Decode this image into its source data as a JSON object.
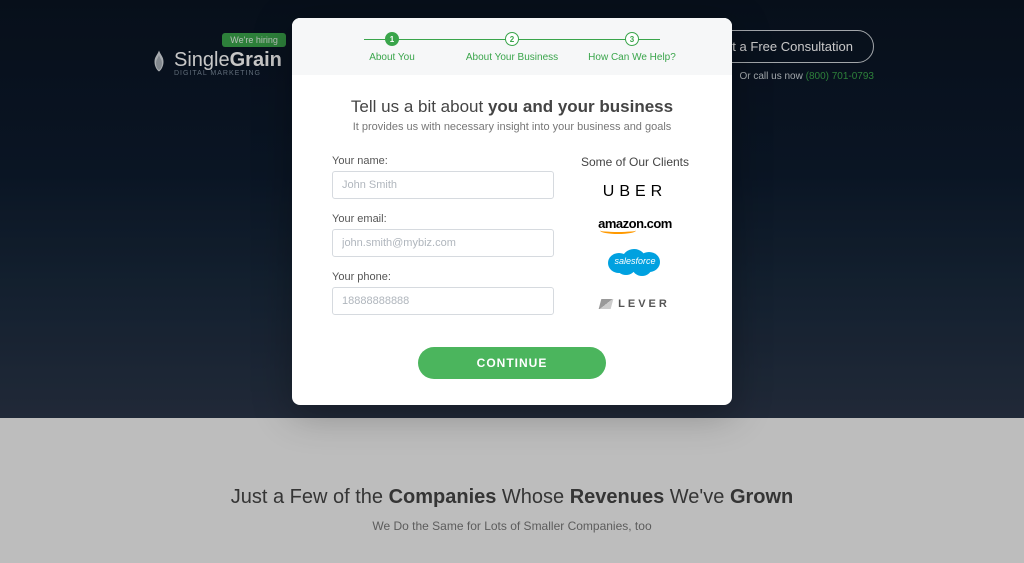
{
  "header": {
    "hiring_badge": "We're hiring",
    "logo_main": "Single",
    "logo_bold": "Grain",
    "logo_sub": "DIGITAL MARKETING",
    "consult_btn": "Get a Free Consultation",
    "call_prefix": "Or call us now ",
    "call_number": "(800) 701-0793"
  },
  "modal": {
    "steps": [
      {
        "num": "1",
        "label": "About You",
        "active": true
      },
      {
        "num": "2",
        "label": "About Your Business",
        "active": false
      },
      {
        "num": "3",
        "label": "How Can We Help?",
        "active": false
      }
    ],
    "title_a": "Tell us a bit about ",
    "title_b": "you and your business",
    "subtitle": "It provides us with necessary insight into your business and goals",
    "name_label": "Your name:",
    "name_placeholder": "John Smith",
    "email_label": "Your email:",
    "email_placeholder": "john.smith@mybiz.com",
    "phone_label": "Your phone:",
    "phone_placeholder": "18888888888",
    "clients_title": "Some of Our Clients",
    "client_uber": "UBER",
    "client_amazon": "amazon.com",
    "client_salesforce": "salesforce",
    "client_lever": "LEVER",
    "continue": "CONTINUE"
  },
  "below": {
    "title_1": "Just a Few of the ",
    "title_2": "Companies",
    "title_3": " Whose ",
    "title_4": "Revenues",
    "title_5": " We've ",
    "title_6": "Grown",
    "sub": "We Do the Same for Lots of Smaller Companies, too"
  }
}
